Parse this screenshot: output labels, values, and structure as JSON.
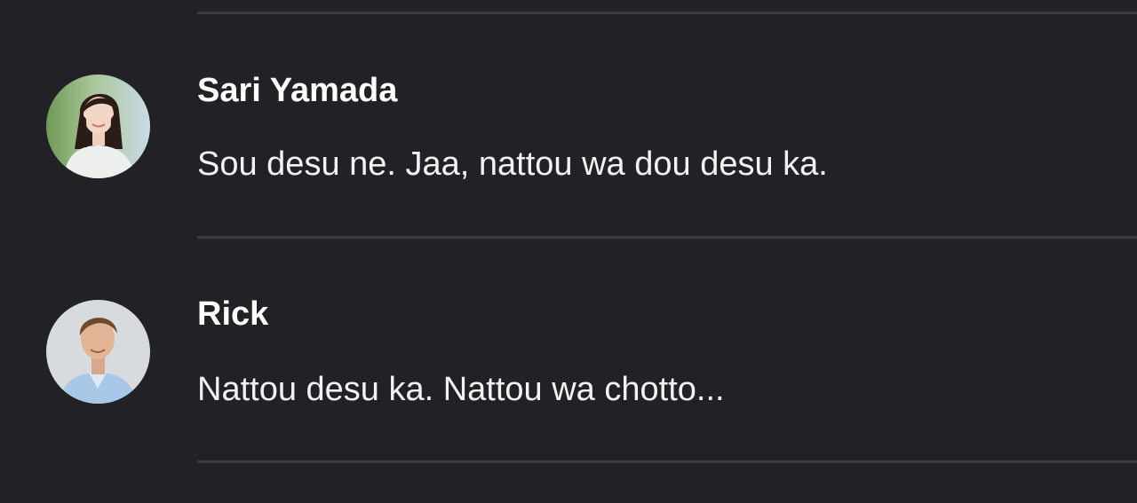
{
  "messages": [
    {
      "sender": "Sari Yamada",
      "text": "Sou desu ne. Jaa, nattou wa dou desu ka."
    },
    {
      "sender": "Rick",
      "text": "Nattou desu ka. Nattou wa chotto..."
    }
  ]
}
